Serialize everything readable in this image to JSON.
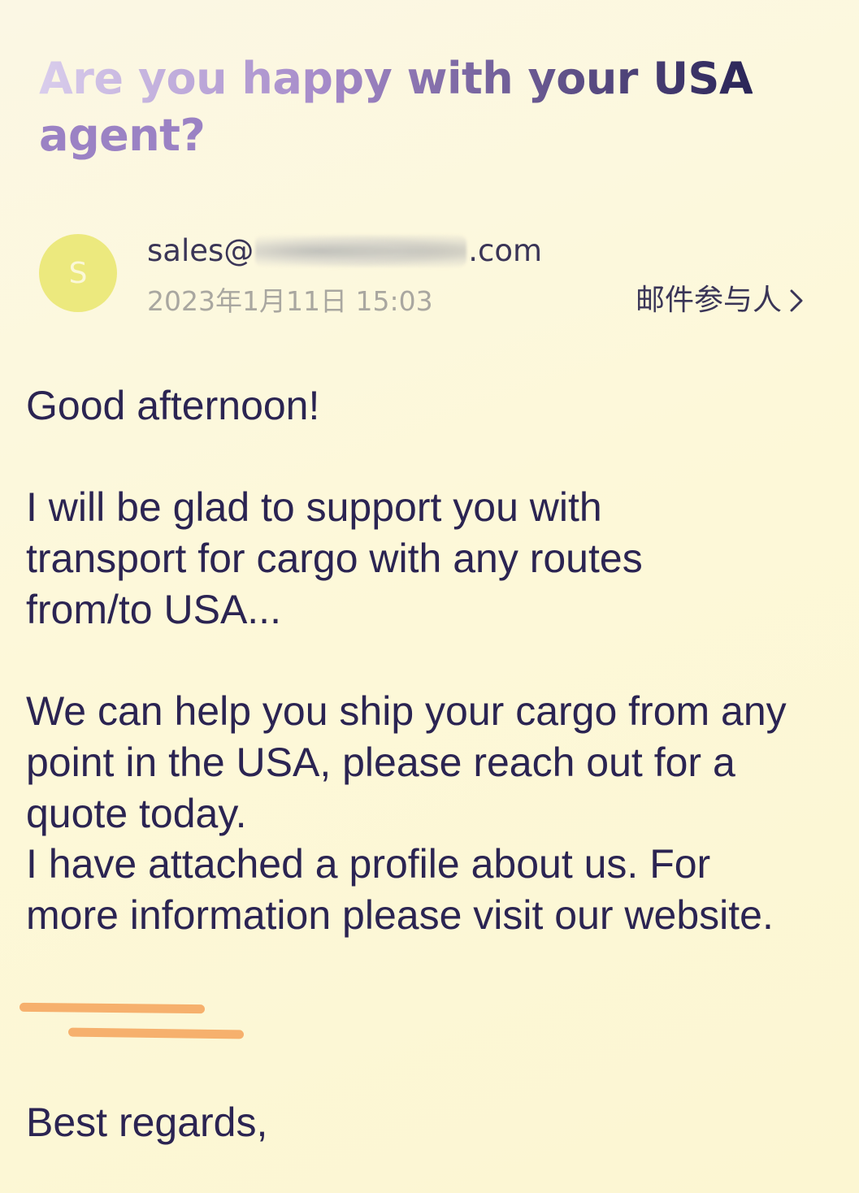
{
  "email": {
    "subject": {
      "part_a": "Are you happy with your USA",
      "part_b": "agent?"
    },
    "sender": {
      "avatar_letter": "S",
      "address_prefix": "sales@",
      "address_suffix": ".com",
      "date": "2023年1月11日 15:03"
    },
    "participants_label": "邮件参与人",
    "body": {
      "greeting": "Good afternoon!",
      "paragraph_1": "I will be glad to support you with transport for cargo with any routes from/to USA...",
      "paragraph_2_line_1": "We can help you ship your cargo from any point in the USA, please reach out for a quote today.",
      "paragraph_2_line_2": "I have attached a profile about us. For more information please visit our website.",
      "closing": "Best regards,"
    }
  },
  "colors": {
    "background": "#fcf7d8",
    "text": "#2b2452",
    "avatar": "#ece97e",
    "highlight_underline": "#f6b06d",
    "meta_text": "#a9a7a0"
  },
  "icons": {
    "participants_chevron": "chevron-right-icon"
  }
}
